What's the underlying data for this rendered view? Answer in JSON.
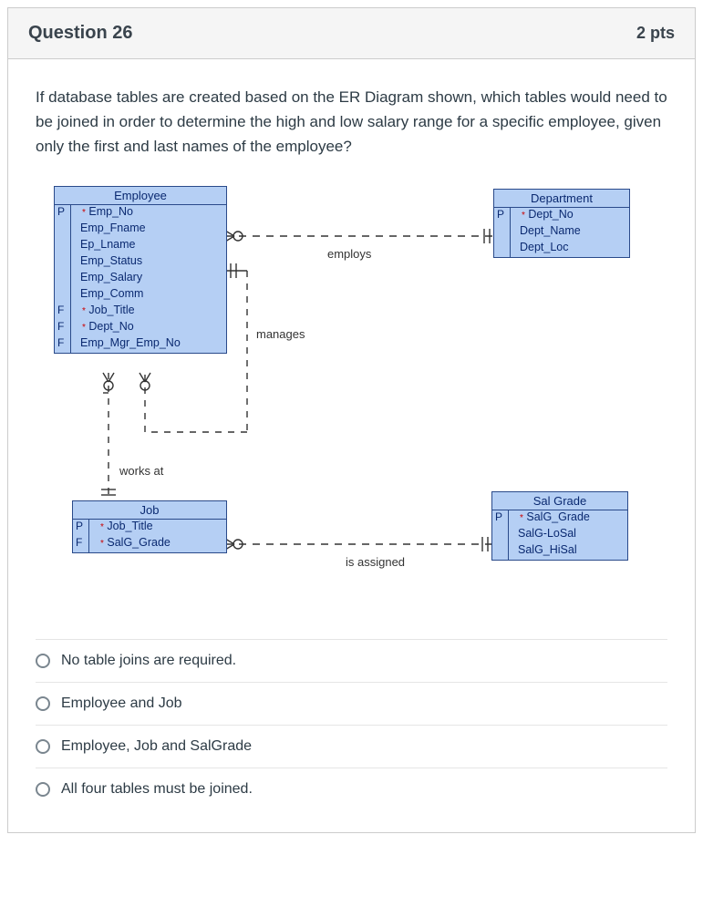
{
  "header": {
    "title": "Question 26",
    "points": "2 pts"
  },
  "prompt": "If database tables are created based on the ER Diagram shown, which tables would need to be joined in order to determine the high and low salary range for a specific employee, given only the first and last names of the employee?",
  "entities": {
    "employee": {
      "title": "Employee",
      "rows": [
        {
          "key": "P",
          "star": true,
          "attr": "Emp_No"
        },
        {
          "key": "",
          "star": false,
          "attr": "Emp_Fname"
        },
        {
          "key": "",
          "star": false,
          "attr": "Ep_Lname"
        },
        {
          "key": "",
          "star": false,
          "attr": "Emp_Status"
        },
        {
          "key": "",
          "star": false,
          "attr": "Emp_Salary"
        },
        {
          "key": "",
          "star": false,
          "attr": "Emp_Comm"
        },
        {
          "key": "F",
          "star": true,
          "attr": "Job_Title"
        },
        {
          "key": "F",
          "star": true,
          "attr": "Dept_No"
        },
        {
          "key": "F",
          "star": false,
          "attr": "Emp_Mgr_Emp_No"
        }
      ]
    },
    "department": {
      "title": "Department",
      "rows": [
        {
          "key": "P",
          "star": true,
          "attr": "Dept_No"
        },
        {
          "key": "",
          "star": false,
          "attr": "Dept_Name"
        },
        {
          "key": "",
          "star": false,
          "attr": "Dept_Loc"
        }
      ]
    },
    "job": {
      "title": "Job",
      "rows": [
        {
          "key": "P",
          "star": true,
          "attr": "Job_Title"
        },
        {
          "key": "F",
          "star": true,
          "attr": "SalG_Grade"
        }
      ]
    },
    "salgrade": {
      "title": "Sal Grade",
      "rows": [
        {
          "key": "P",
          "star": true,
          "attr": "SalG_Grade"
        },
        {
          "key": "",
          "star": false,
          "attr": "SalG-LoSal"
        },
        {
          "key": "",
          "star": false,
          "attr": "SalG_HiSal"
        }
      ]
    }
  },
  "relations": {
    "employs": "employs",
    "manages": "manages",
    "worksat": "works at",
    "isassigned": "is assigned"
  },
  "answers": [
    "No table joins are required.",
    "Employee and Job",
    "Employee, Job and SalGrade",
    "All four tables must be joined."
  ]
}
